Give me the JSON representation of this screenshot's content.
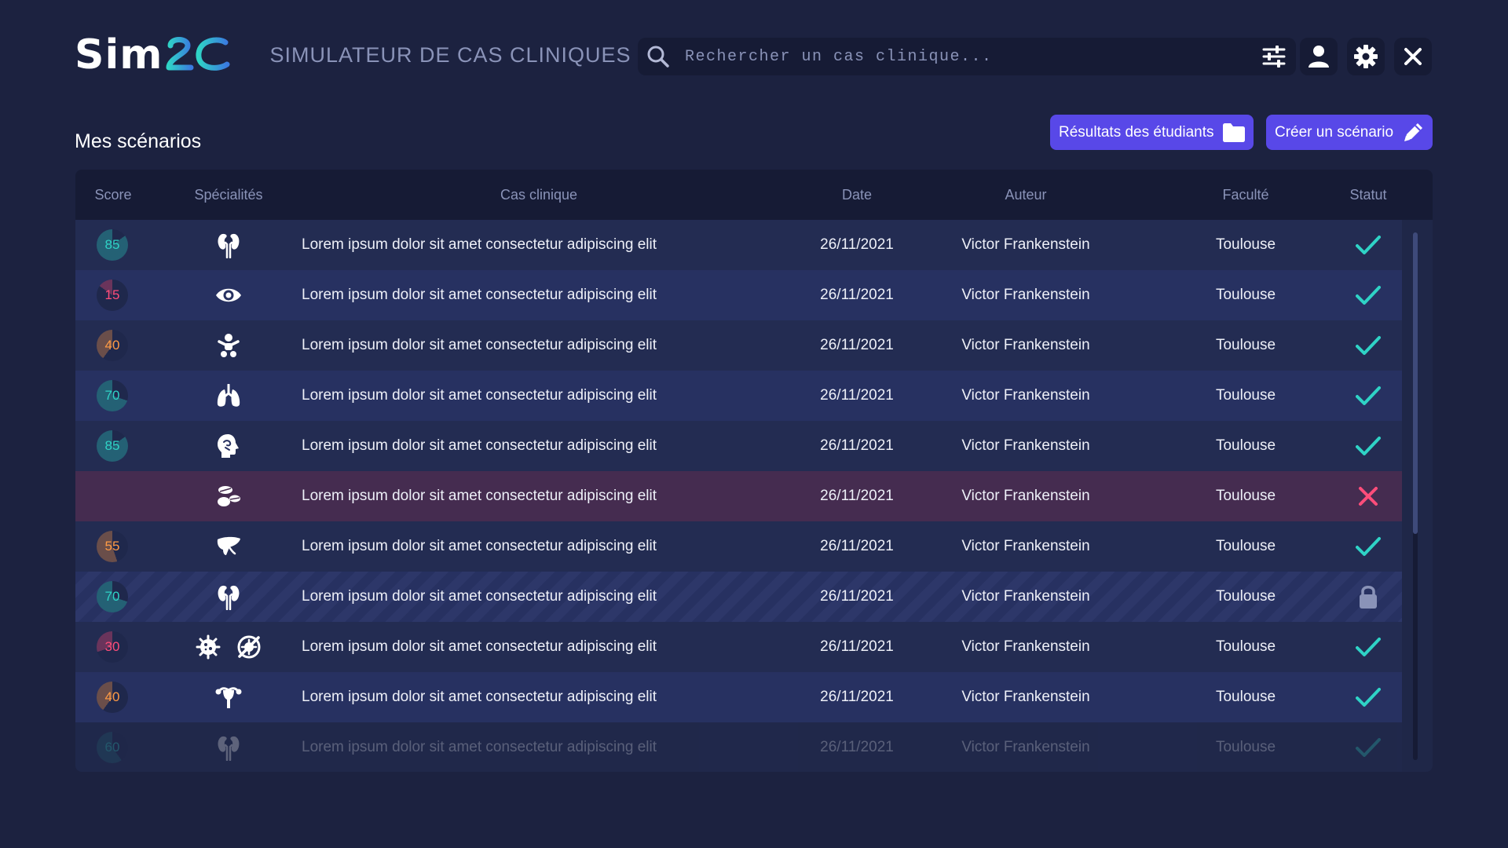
{
  "app": {
    "logo_text": "Sim",
    "subtitle": "SIMULATEUR DE CAS CLINIQUES"
  },
  "search": {
    "placeholder": "Rechercher un cas clinique...",
    "value": ""
  },
  "page_title": "Mes scénarios",
  "actions": {
    "results_label": "Résultats des étudiants",
    "create_label": "Créer un scénario"
  },
  "colors": {
    "background": "#1c2240",
    "panel": "#161b35",
    "accent": "#5848e8",
    "logo_gradient": [
      "#2fd3c6",
      "#3a7be0"
    ],
    "status_ok": "#2fd3c6",
    "status_refused": "#ff4d7a",
    "score_high": "#2fd3c6",
    "score_mid": "#ff9b45",
    "score_low": "#ff4d7a"
  },
  "table": {
    "columns": [
      "Score",
      "Spécialités",
      "Cas clinique",
      "Date",
      "Auteur",
      "Faculté",
      "Statut"
    ],
    "rows": [
      {
        "score": "85",
        "score_color": "#2fd3c6",
        "specialties": [
          "kidneys-icon"
        ],
        "case": "Lorem ipsum dolor sit amet consectetur adipiscing elit",
        "date": "26/11/2021",
        "author": "Victor Frankenstein",
        "faculty": "Toulouse",
        "status": "check-icon"
      },
      {
        "score": "15",
        "score_color": "#ff4d7a",
        "specialties": [
          "eye-icon"
        ],
        "case": "Lorem ipsum dolor sit amet consectetur adipiscing elit",
        "date": "26/11/2021",
        "author": "Victor Frankenstein",
        "faculty": "Toulouse",
        "status": "check-icon"
      },
      {
        "score": "40",
        "score_color": "#ff9b45",
        "specialties": [
          "baby-icon"
        ],
        "case": "Lorem ipsum dolor sit amet consectetur adipiscing elit",
        "date": "26/11/2021",
        "author": "Victor Frankenstein",
        "faculty": "Toulouse",
        "status": "check-icon"
      },
      {
        "score": "70",
        "score_color": "#2fd3c6",
        "specialties": [
          "lungs-icon"
        ],
        "case": "Lorem ipsum dolor sit amet consectetur adipiscing elit",
        "date": "26/11/2021",
        "author": "Victor Frankenstein",
        "faculty": "Toulouse",
        "status": "check-icon"
      },
      {
        "score": "85",
        "score_color": "#2fd3c6",
        "specialties": [
          "head-profile-icon"
        ],
        "case": "Lorem ipsum dolor sit amet consectetur adipiscing elit",
        "date": "26/11/2021",
        "author": "Victor Frankenstein",
        "faculty": "Toulouse",
        "status": "check-icon"
      },
      {
        "score": "",
        "score_color": "#2fd3c6",
        "specialties": [
          "pills-icon"
        ],
        "case": "Lorem ipsum dolor sit amet consectetur adipiscing elit",
        "date": "26/11/2021",
        "author": "Victor Frankenstein",
        "faculty": "Toulouse",
        "status": "cross-icon"
      },
      {
        "score": "55",
        "score_color": "#ff9b45",
        "specialties": [
          "liver-icon"
        ],
        "case": "Lorem ipsum dolor sit amet consectetur adipiscing elit",
        "date": "26/11/2021",
        "author": "Victor Frankenstein",
        "faculty": "Toulouse",
        "status": "check-icon"
      },
      {
        "score": "70",
        "score_color": "#2fd3c6",
        "specialties": [
          "kidneys-icon"
        ],
        "case": "Lorem ipsum dolor sit amet consectetur adipiscing elit",
        "date": "26/11/2021",
        "author": "Victor Frankenstein",
        "faculty": "Toulouse",
        "status": "lock-icon"
      },
      {
        "score": "30",
        "score_color": "#ff4d7a",
        "specialties": [
          "virus-icon",
          "no-virus-icon"
        ],
        "case": "Lorem ipsum dolor sit amet consectetur adipiscing elit",
        "date": "26/11/2021",
        "author": "Victor Frankenstein",
        "faculty": "Toulouse",
        "status": "check-icon"
      },
      {
        "score": "40",
        "score_color": "#ff9b45",
        "specialties": [
          "uterus-icon"
        ],
        "case": "Lorem ipsum dolor sit amet consectetur adipiscing elit",
        "date": "26/11/2021",
        "author": "Victor Frankenstein",
        "faculty": "Toulouse",
        "status": "check-icon"
      },
      {
        "score": "60",
        "score_color": "#2fd3c6",
        "specialties": [
          "kidneys-icon"
        ],
        "case": "Lorem ipsum dolor sit amet consectetur adipiscing elit",
        "date": "26/11/2021",
        "author": "Victor Frankenstein",
        "faculty": "Toulouse",
        "status": "check-icon"
      }
    ]
  }
}
